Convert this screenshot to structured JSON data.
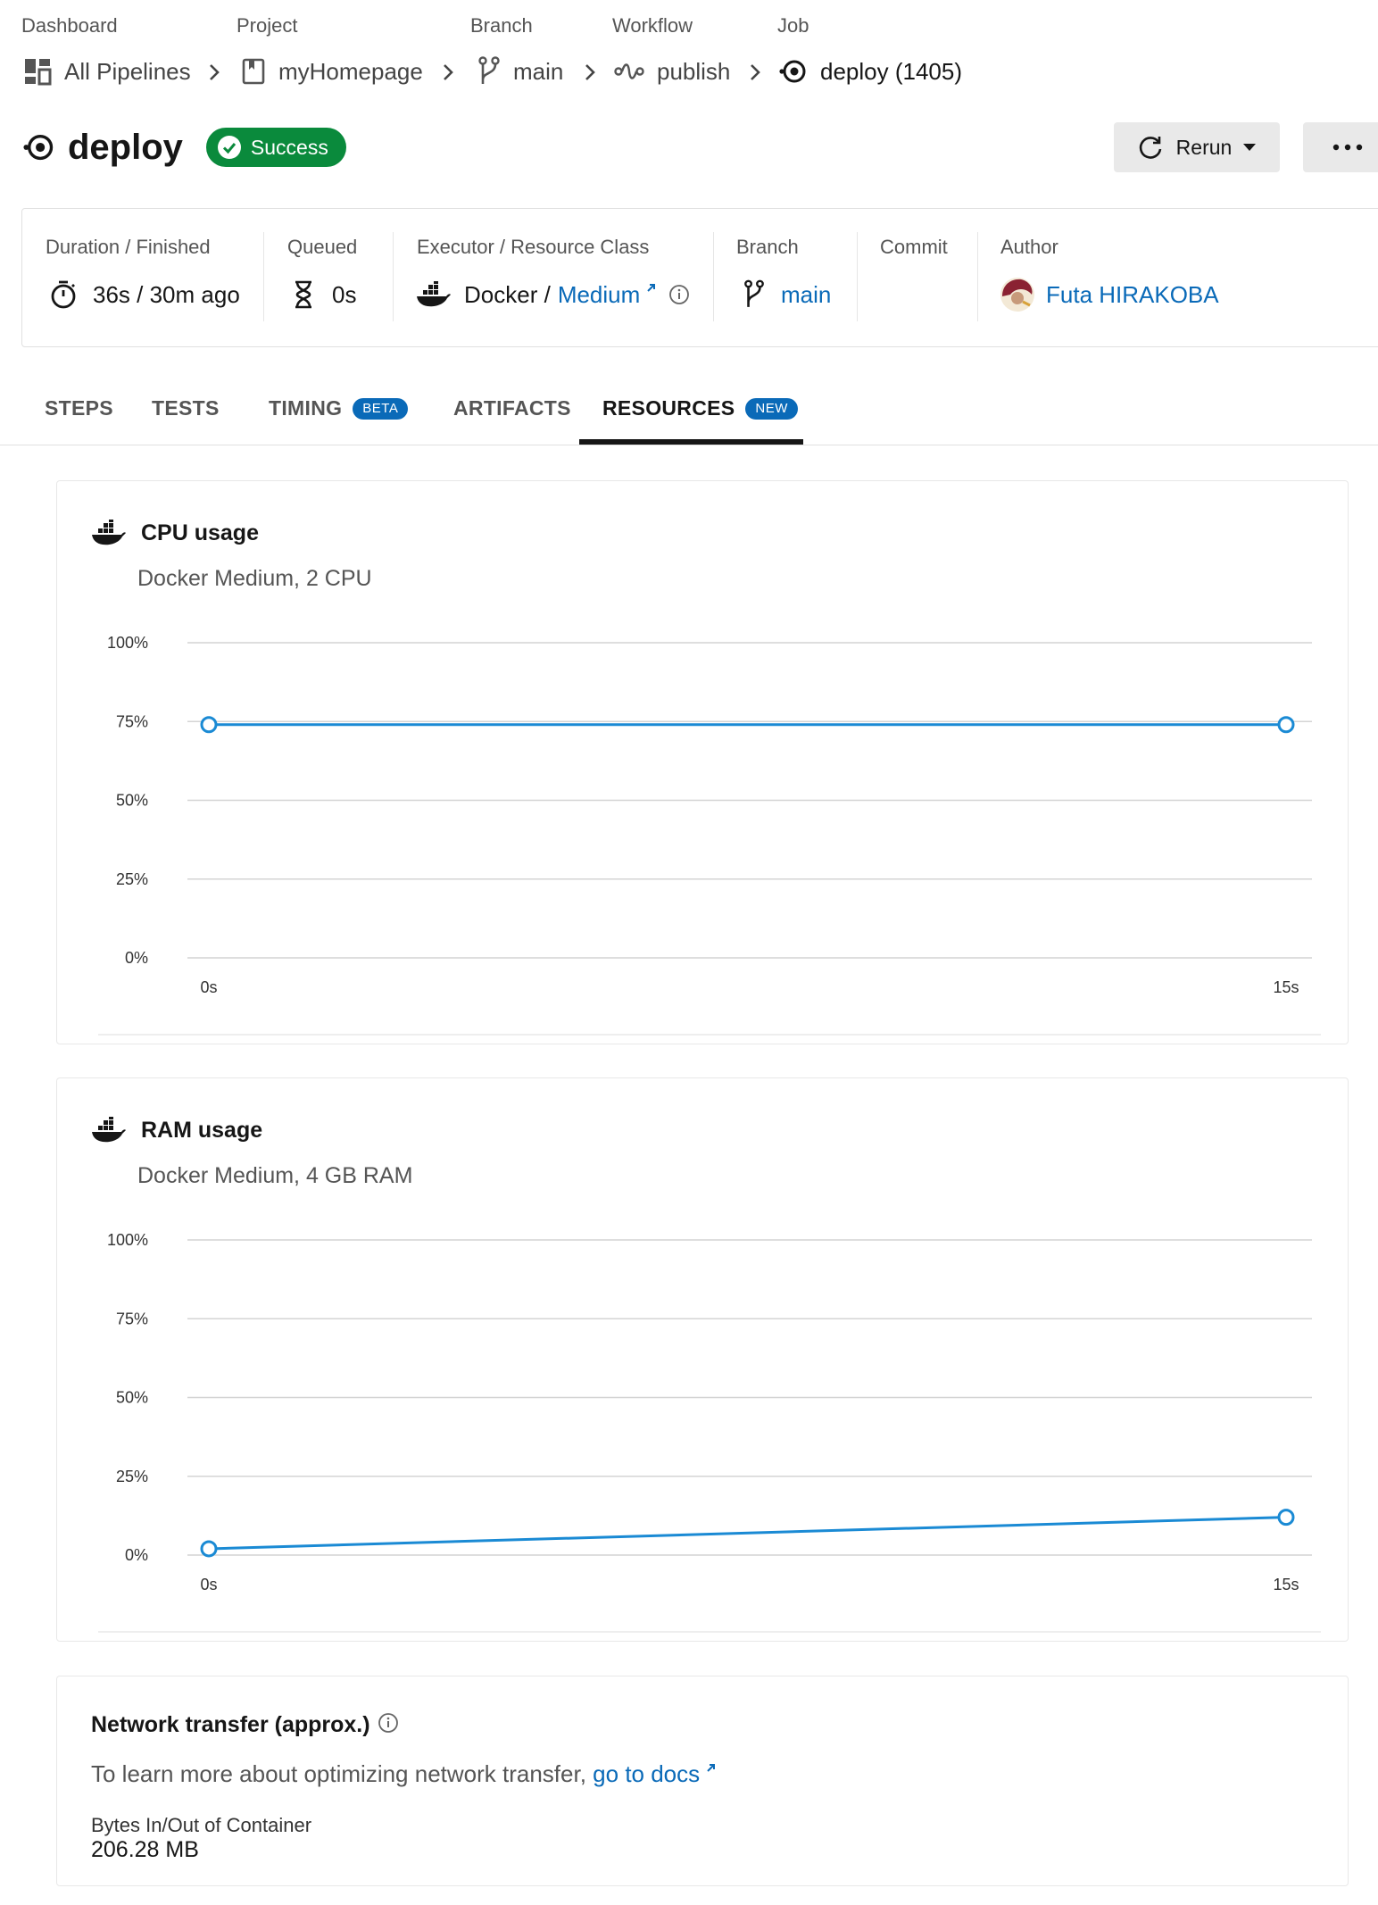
{
  "breadcrumbs": [
    {
      "heading": "Dashboard",
      "label": "All Pipelines"
    },
    {
      "heading": "Project",
      "label": "myHomepage"
    },
    {
      "heading": "Branch",
      "label": "main"
    },
    {
      "heading": "Workflow",
      "label": "publish"
    },
    {
      "heading": "Job",
      "label": "deploy (1405)"
    }
  ],
  "job": {
    "title": "deploy",
    "status": "Success",
    "rerun_label": "Rerun"
  },
  "meta": {
    "duration": {
      "label": "Duration / Finished",
      "value": "36s / 30m ago"
    },
    "queued": {
      "label": "Queued",
      "value": "0s"
    },
    "executor": {
      "label": "Executor / Resource Class",
      "value_prefix": "Docker / ",
      "link": "Medium"
    },
    "branch": {
      "label": "Branch",
      "value": "main"
    },
    "commit": {
      "label": "Commit"
    },
    "author": {
      "label": "Author",
      "value": "Futa HIRAKOBA"
    }
  },
  "tabs": [
    {
      "label": "STEPS"
    },
    {
      "label": "TESTS"
    },
    {
      "label": "TIMING",
      "badge": "BETA"
    },
    {
      "label": "ARTIFACTS"
    },
    {
      "label": "RESOURCES",
      "badge": "NEW",
      "active": true
    }
  ],
  "cpu_panel": {
    "title": "CPU usage",
    "subtitle": "Docker Medium, 2 CPU"
  },
  "ram_panel": {
    "title": "RAM usage",
    "subtitle": "Docker Medium, 4 GB RAM"
  },
  "network": {
    "title": "Network transfer (approx.)",
    "description": "To learn more about optimizing network transfer, ",
    "docs_link": "go to docs",
    "bytes_label": "Bytes In/Out of Container",
    "bytes_value": "206.28 MB"
  },
  "colors": {
    "accent": "#0a6ab8",
    "success": "#0a8a3c",
    "series": "#1a8ad4"
  },
  "chart_data": [
    {
      "type": "line",
      "x": [
        "0s",
        "15s"
      ],
      "series": [
        {
          "values": [
            74,
            74
          ]
        }
      ],
      "yticks": [
        "0%",
        "25%",
        "50%",
        "75%",
        "100%"
      ],
      "ylim": [
        0,
        100
      ],
      "grid": true
    },
    {
      "type": "line",
      "x": [
        "0s",
        "15s"
      ],
      "series": [
        {
          "values": [
            2,
            12
          ]
        }
      ],
      "yticks": [
        "0%",
        "25%",
        "50%",
        "75%",
        "100%"
      ],
      "ylim": [
        0,
        100
      ],
      "grid": true
    }
  ]
}
